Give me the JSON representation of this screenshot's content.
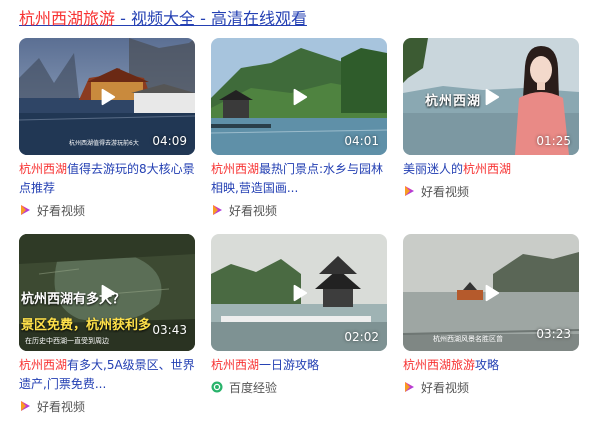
{
  "header": {
    "part1": "杭州西湖旅游",
    "sep1": " - ",
    "part2": "视频大全",
    "sep2": " - ",
    "part3": "高清在线观看"
  },
  "videos": [
    {
      "title_hl": "杭州西湖",
      "title_rest": "值得去游玩的8大核心景点推荐",
      "duration": "04:09",
      "source": "好看视频",
      "source_icon": "haokan-icon",
      "overlay": "杭州西湖值得去游玩前6大"
    },
    {
      "title_hl": "杭州西湖",
      "title_rest": "最热门景点:水乡与园林相映,营造国画...",
      "duration": "04:01",
      "source": "好看视频",
      "source_icon": "haokan-icon"
    },
    {
      "title_prefix": "美丽迷人的",
      "title_hl": "杭州西湖",
      "title_rest": "",
      "duration": "01:25",
      "source": "好看视频",
      "source_icon": "haokan-icon",
      "overlay": "杭州西湖"
    },
    {
      "title_hl": "杭州西湖",
      "title_rest": "有多大,5A级景区、世界遗产,门票免费...",
      "duration": "03:43",
      "source": "好看视频",
      "source_icon": "haokan-icon",
      "overlay": "杭州西湖有多大？",
      "overlay2": "景区免费，杭州获利多",
      "overlay3": "在历史中西湖一直受到周边"
    },
    {
      "title_hl": "杭州西湖",
      "title_rest": "一日游攻略",
      "duration": "02:02",
      "source": "百度经验",
      "source_icon": "baidu-jingyan-icon"
    },
    {
      "title_hl": "杭州西湖旅游",
      "title_rest": "攻略",
      "duration": "03:23",
      "source": "好看视频",
      "source_icon": "haokan-icon",
      "overlay": "杭州西湖风景名胜区曾"
    }
  ],
  "colors": {
    "link": "#2440b3",
    "highlight": "#f73131",
    "source_text": "#555555"
  }
}
